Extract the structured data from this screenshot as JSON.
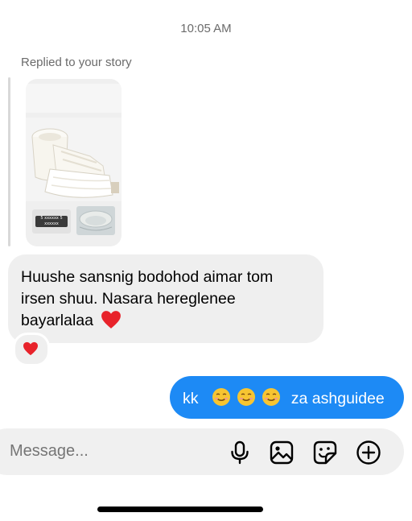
{
  "timestamp": "10:05 AM",
  "reply_header": "Replied to your story",
  "story": {
    "thumb_caption": "5 xxxxxx 5 xxxxxx"
  },
  "incoming_message": {
    "line1": "Huushe sansnig bodohod aimar tom",
    "line2": "irsen shuu. Nasara hereglenee",
    "line3": "bayarlalaa"
  },
  "outgoing_message": {
    "prefix": "kk",
    "suffix": "za ashguidee"
  },
  "composer": {
    "placeholder": "Message..."
  },
  "icons": [
    "heart-emoji",
    "smiling-emoji",
    "microphone-icon",
    "gallery-icon",
    "sticker-icon",
    "plus-circle-icon"
  ],
  "colors": {
    "outgoing_bubble": "#1d8af5",
    "incoming_bubble": "#efefef",
    "heart": "#e8232b"
  }
}
